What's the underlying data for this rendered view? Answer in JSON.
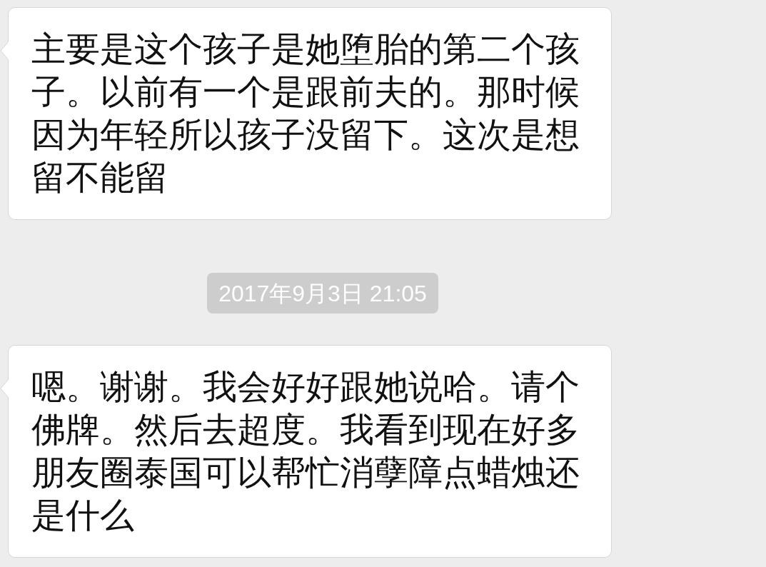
{
  "messages": [
    {
      "kind": "bubble",
      "text": "主要是这个孩子是她堕胎的第二个孩子。以前有一个是跟前夫的。那时候因为年轻所以孩子没留下。这次是想留不能留"
    },
    {
      "kind": "timestamp",
      "text": "2017年9月3日 21:05"
    },
    {
      "kind": "bubble",
      "text": "嗯。谢谢。我会好好跟她说哈。请个佛牌。然后去超度。我看到现在好多朋友圈泰国可以帮忙消孽障点蜡烛还是什么"
    }
  ]
}
